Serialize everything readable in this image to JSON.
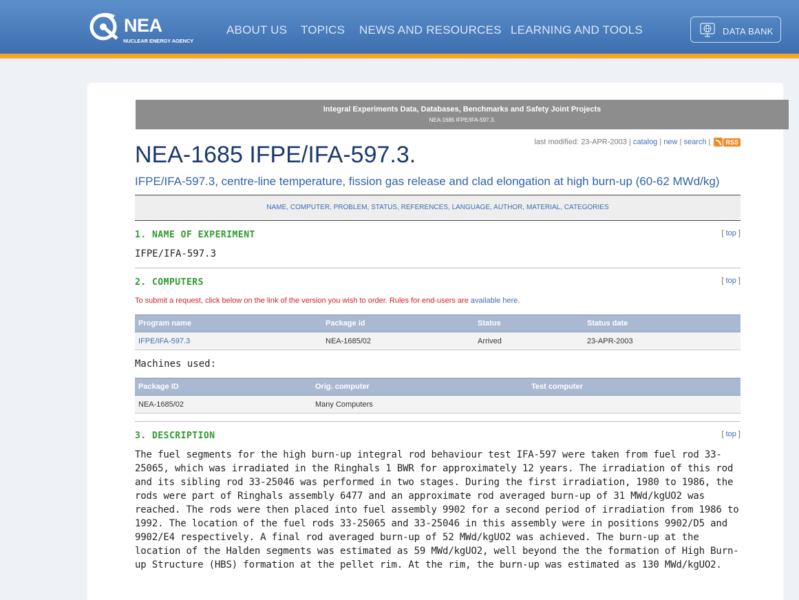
{
  "header": {
    "logo_acronym": "NEA",
    "logo_full": "NUCLEAR ENERGY AGENCY",
    "nav": [
      "ABOUT US",
      "TOPICS",
      "NEWS AND RESOURCES",
      "LEARNING AND TOOLS"
    ],
    "databank_label": "DATA BANK",
    "icons": {
      "logo": "nea-logo-icon",
      "databank": "globe-icon"
    },
    "colors": {
      "bar": "#4a7dbd",
      "stripe": "#f5a623"
    }
  },
  "banner": {
    "title": "Integral Experiments Data, Databases, Benchmarks and Safety Joint Projects",
    "subtitle": "NEA-1685 IFPE/IFA-597.3."
  },
  "meta": {
    "last_modified": "last modified: 23-APR-2003 |",
    "links": [
      "catalog",
      "new",
      "search"
    ],
    "rss_label": "RSS"
  },
  "page": {
    "title": "NEA-1685 IFPE/IFA-597.3.",
    "subtitle": "IFPE/IFA-597.3, centre-line temperature, fission gas release and clad elongation at high burn-up (60-62 MWd/kg)"
  },
  "anchors": [
    "NAME",
    "COMPUTER",
    "PROBLEM",
    "STATUS",
    "REFERENCES",
    "LANGUAGE",
    "AUTHOR",
    "MATERIAL",
    "CATEGORIES"
  ],
  "top_label": "top",
  "sections": {
    "name": {
      "heading": "1. NAME OF EXPERIMENT",
      "value": "IFPE/IFA-597.3"
    },
    "computers": {
      "heading": "2. COMPUTERS",
      "request_text": "To submit a request, click below on the link of the version you wish to order. Rules for end-users are",
      "request_link": "available here",
      "programs": {
        "headers": [
          "Program name",
          "Package id",
          "Status",
          "Status date"
        ],
        "rows": [
          [
            "IFPE/IFA-597.3",
            "NEA-1685/02",
            "Arrived",
            "23-APR-2003"
          ]
        ]
      },
      "machines_label": "Machines used:",
      "machines": {
        "headers": [
          "Package ID",
          "Orig. computer",
          "Test computer"
        ],
        "rows": [
          [
            "NEA-1685/02",
            "Many Computers",
            ""
          ]
        ]
      }
    },
    "description": {
      "heading": "3. DESCRIPTION",
      "text": "The fuel segments for the high burn-up integral rod behaviour test IFA-597 were taken from fuel rod 33-25065, which was irradiated in the Ringhals 1 BWR for approximately 12 years. The irradiation of this rod and its sibling rod 33-25046 was performed in two stages. During the first irradiation, 1980 to 1986, the rods were part of Ringhals assembly 6477 and an approximate rod averaged burn-up of 31 MWd/kgUO2 was reached. The rods were then placed into fuel assembly 9902 for a second period of irradiation from 1986 to 1992. The location of the fuel rods 33-25065 and 33-25046 in this assembly were in positions 9902/D5 and 9902/E4 respectively. A final rod averaged burn-up of 52 MWd/kgUO2 was achieved. The burn-up at the location of the Halden segments was estimated as 59 MWd/kgUO2, well beyond the the formation of High Burn-up Structure (HBS) formation at the pellet rim. At the rim, the burn-up was estimated as 130 MWd/kgUO2."
    }
  }
}
